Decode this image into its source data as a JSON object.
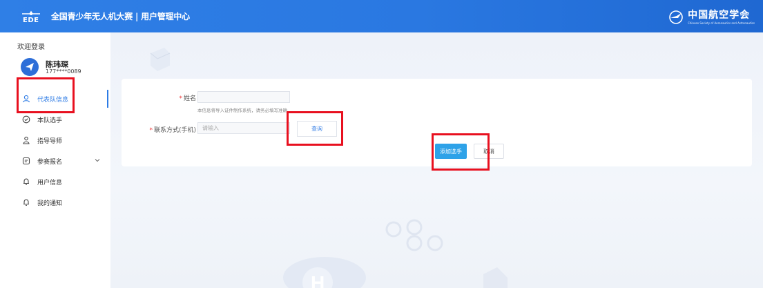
{
  "header": {
    "logo_text": "EDE",
    "title": "全国青少年无人机大赛 | 用户管理中心",
    "brand_name": "中国航空学会",
    "brand_subtitle": "Chinese Society of Aeronautics and Astronautics"
  },
  "sidebar": {
    "welcome": "欢迎登录",
    "user": {
      "name": "陈玮琛",
      "phone": "177****0089"
    },
    "items": [
      {
        "label": "代表队信息",
        "icon": "user-icon",
        "active": true
      },
      {
        "label": "本队选手",
        "icon": "check-circle-icon"
      },
      {
        "label": "指导导师",
        "icon": "users-icon"
      },
      {
        "label": "参赛报名",
        "icon": "form-icon",
        "has_submenu": true
      },
      {
        "label": "用户信息",
        "icon": "bell-icon"
      },
      {
        "label": "我的通知",
        "icon": "bell-icon"
      }
    ]
  },
  "form": {
    "name_label": "姓名",
    "name_value": "",
    "name_hint": "本信息将导入证件制作系统，请务必填写准确",
    "phone_label": "联系方式(手机)",
    "phone_placeholder": "请输入",
    "query_label": "查询",
    "add_label": "添加选手",
    "cancel_label": "取消",
    "required_mark": "*"
  },
  "colors": {
    "header_bg": "#2f7fe6",
    "accent": "#2d7be5",
    "primary_button": "#2ea2e8",
    "highlight_box": "#e8101f"
  }
}
